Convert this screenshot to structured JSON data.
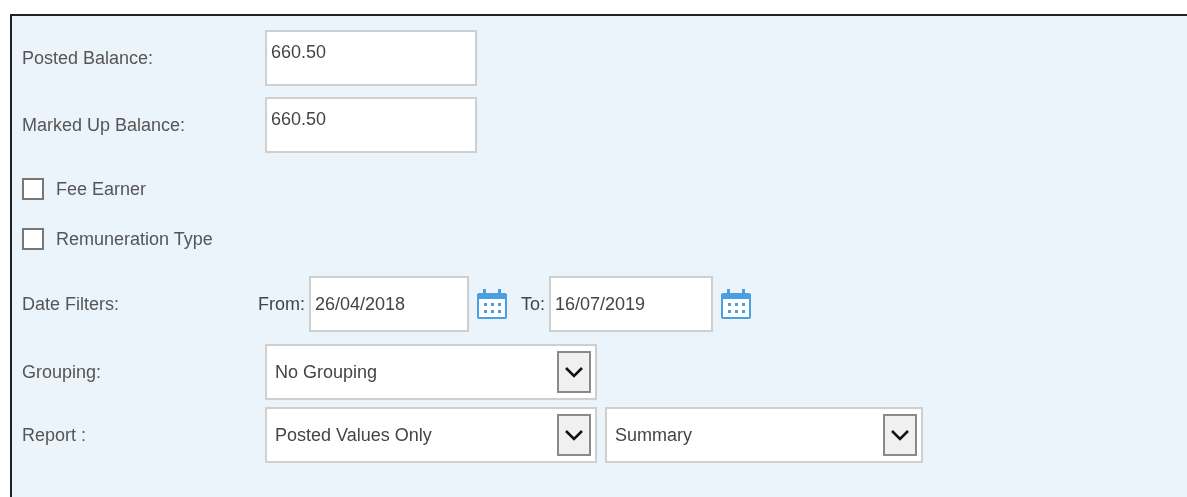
{
  "fields": [
    {
      "label": "Posted Balance:",
      "value": "660.50"
    },
    {
      "label": "Marked Up Balance:",
      "value": "660.50"
    }
  ],
  "checkboxes": [
    {
      "label": "Fee Earner",
      "checked": false
    },
    {
      "label": "Remuneration Type",
      "checked": false
    }
  ],
  "date_filters": {
    "label": "Date Filters:",
    "from_label": "From:",
    "from": "26/04/2018",
    "to_label": "To:",
    "to": "16/07/2019"
  },
  "grouping": {
    "label": "Grouping:",
    "value": "No Grouping"
  },
  "report": {
    "label": "Report :",
    "value": "Posted Values Only",
    "mode": "Summary"
  }
}
